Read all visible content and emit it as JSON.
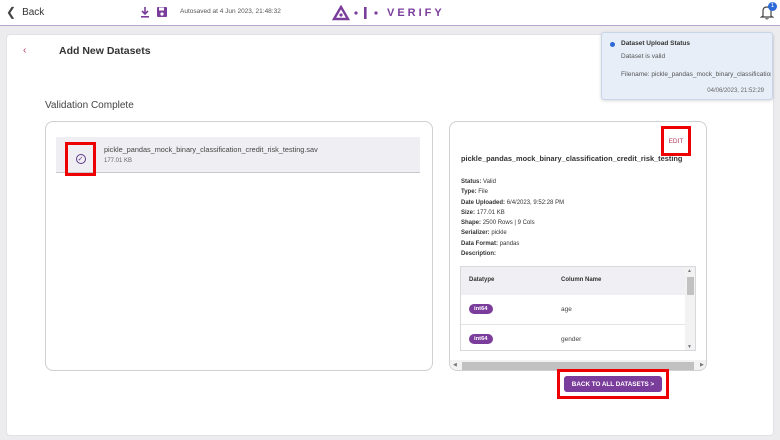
{
  "topbar": {
    "back_label": "Back",
    "autosave_text": "Autosaved at 4 Jun 2023, 21:48:32",
    "logo_text": "VERIFY",
    "notification_count": "1",
    "accent_color": "#7b3d9b"
  },
  "page": {
    "title": "Add New Datasets",
    "validation_title": "Validation Complete"
  },
  "file_item": {
    "name": "pickle_pandas_mock_binary_classification_credit_risk_testing.sav",
    "size": "177.01 KB"
  },
  "details": {
    "edit_label": "EDIT",
    "dataset_name": "pickle_pandas_mock_binary_classification_credit_risk_testing",
    "meta": [
      {
        "label": "Status:",
        "value": "Valid"
      },
      {
        "label": "Type:",
        "value": "File"
      },
      {
        "label": "Date Uploaded:",
        "value": "6/4/2023, 9:52:28 PM"
      },
      {
        "label": "Size:",
        "value": "177.01 KB"
      },
      {
        "label": "Shape:",
        "value": "2500 Rows | 9 Cols"
      },
      {
        "label": "Serializer:",
        "value": "pickle"
      },
      {
        "label": "Data Format:",
        "value": "pandas"
      },
      {
        "label": "Description:",
        "value": ""
      }
    ],
    "table": {
      "headers": [
        "Datatype",
        "Column Name"
      ],
      "rows": [
        {
          "datatype": "int64",
          "column": "age"
        },
        {
          "datatype": "int64",
          "column": "gender"
        }
      ]
    }
  },
  "back_all_label": "BACK TO ALL DATASETS >",
  "toast": {
    "title": "Dataset Upload Status",
    "message": "Dataset is valid",
    "filename": "Filename: pickle_pandas_mock_binary_classification_credit_risk_testing.sav",
    "time": "04/06/2023, 21:52:29"
  }
}
